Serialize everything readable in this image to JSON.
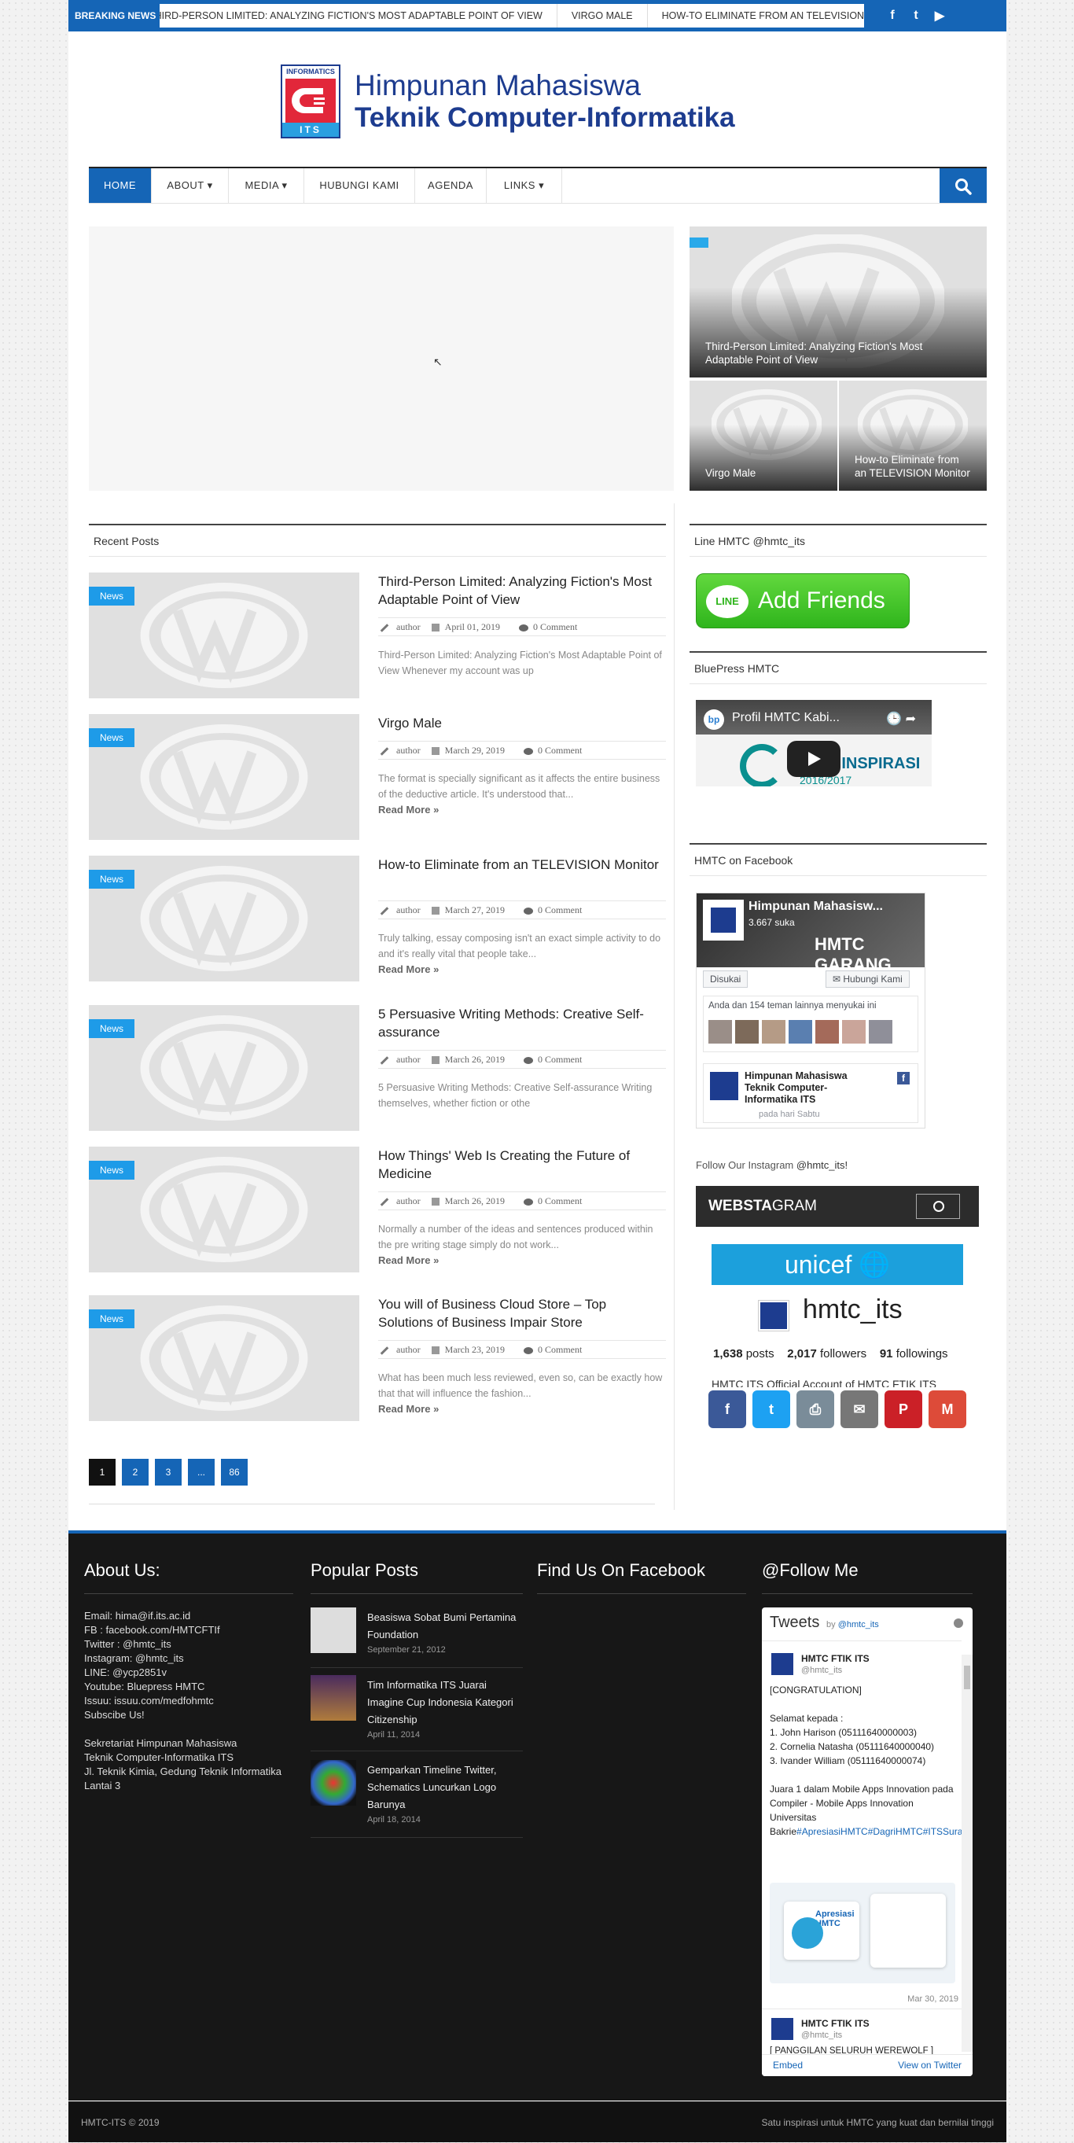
{
  "topbar": {
    "breaking_label": "BREAKING NEWS",
    "ticker": [
      "Third-Person Limited: Analyzing Fiction's Most Adaptable Point of View",
      "Virgo Male",
      "How-to Eliminate from an TELEVISION Monitor"
    ],
    "social": [
      "f",
      "t",
      "▶"
    ]
  },
  "header": {
    "logo_top": "INFORMATICS",
    "logo_bottom": "ITS",
    "title_line1": "Himpunan Mahasiswa",
    "title_line2": "Teknik Computer-Informatika"
  },
  "nav": {
    "items": [
      "HOME",
      "ABOUT ▾",
      "MEDIA ▾",
      "HUBUNGI KAMI",
      "AGENDA",
      "LINKS ▾"
    ]
  },
  "hero": {
    "cursor": "↖",
    "tiles": [
      {
        "caption": "Third-Person Limited: Analyzing Fiction's Most Adaptable Point of View"
      },
      {
        "caption": "Virgo Male"
      },
      {
        "caption": "How-to Eliminate from an TELEVISION Monitor"
      }
    ]
  },
  "recent": {
    "heading": "Recent Posts",
    "posts": [
      {
        "tag": "News",
        "title": "Third-Person Limited: Analyzing Fiction's Most Adaptable Point of View",
        "author": "author",
        "date": "April 01, 2019",
        "comments": "0 Comment",
        "excerpt": "Third-Person Limited: Analyzing Fiction's Most Adaptable Point of View Whenever my account was up",
        "read_more": ""
      },
      {
        "tag": "News",
        "title": "Virgo Male",
        "author": "author",
        "date": "March 29, 2019",
        "comments": "0 Comment",
        "excerpt": "The format is specially significant as it affects the entire business of the deductive article. It's understood that...",
        "read_more": "Read More »"
      },
      {
        "tag": "News",
        "title": "How-to Eliminate from an TELEVISION Monitor",
        "author": "author",
        "date": "March 27, 2019",
        "comments": "0 Comment",
        "excerpt": "Truly talking, essay composing isn't an exact simple activity to do and it's really vital that people take...",
        "read_more": "Read More »"
      },
      {
        "tag": "News",
        "title": "5 Persuasive Writing Methods: Creative Self-assurance",
        "author": "author",
        "date": "March 26, 2019",
        "comments": "0 Comment",
        "excerpt": "5 Persuasive Writing Methods: Creative Self-assurance Writing themselves, whether fiction or othe",
        "read_more": ""
      },
      {
        "tag": "News",
        "title": "How Things' Web Is Creating the Future of Medicine",
        "author": "author",
        "date": "March 26, 2019",
        "comments": "0 Comment",
        "excerpt": "Normally a number of the ideas and sentences produced within the pre writing stage simply do not work...",
        "read_more": "Read More »"
      },
      {
        "tag": "News",
        "title": "You will of Business Cloud Store – Top Solutions of Business Impair Store",
        "author": "author",
        "date": "March 23, 2019",
        "comments": "0 Comment",
        "excerpt": "What has been much less reviewed, even so, can be exactly how that that will influence the fashion...",
        "read_more": "Read More »"
      }
    ],
    "pager": [
      "1",
      "2",
      "3",
      "...",
      "86"
    ]
  },
  "sidebar": {
    "line_heading": "Line HMTC @hmtc_its",
    "line_bubble": "LINE",
    "line_button": "Add Friends",
    "bluepress_heading": "BluePress HMTC",
    "video_logo": "bp",
    "video_title": "Profil HMTC Kabi...",
    "video_icons": "🕒  ➦",
    "video_inspirasi": "HMTC INSPIRASI",
    "video_year": "2016/2017",
    "facebook_heading": "HMTC on Facebook",
    "fb_name": "Himpunan Mahasisw...",
    "fb_likes": "3.667 suka",
    "fb_cover_text": "HMTC GARANG",
    "fb_like_btn": "Disukai",
    "fb_contact_btn": "✉ Hubungi Kami",
    "fb_friends_text": "Anda dan 154 teman lainnya menyukai ini",
    "fb_post_name": "Himpunan Mahasiswa Teknik Computer-Informatika ITS",
    "fb_post_date": "pada hari Sabtu",
    "ig_label": "Follow Our Instagram",
    "ig_label_handle": "@hmtc_its!",
    "websta_a": "WEBSTA",
    "websta_b": "GRAM",
    "unicef": "unicef 🌐",
    "ig_handle": "hmtc_its",
    "ig_posts": "1,638",
    "ig_posts_label": "posts",
    "ig_followers": "2,017",
    "ig_followers_label": "followers",
    "ig_following": "91",
    "ig_following_label": "followings",
    "ig_bio": "HMTC ITS  Official Account of HMTC FTIK ITS",
    "share": [
      {
        "label": "f",
        "color": "#3b5998"
      },
      {
        "label": "t",
        "color": "#1da1f2"
      },
      {
        "label": "⎙",
        "color": "#7a8c99"
      },
      {
        "label": "✉",
        "color": "#777777"
      },
      {
        "label": "P",
        "color": "#cb2027"
      },
      {
        "label": "M",
        "color": "#dd4b39"
      }
    ]
  },
  "footer": {
    "about_heading": "About Us:",
    "about_lines": [
      "Email: hima@if.its.ac.id",
      "FB : facebook.com/HMTCFTIf",
      "Twitter : @hmtc_its",
      "Instagram: @hmtc_its",
      "LINE: @ycp2851v",
      "Youtube: Bluepress HMTC",
      "Issuu: issuu.com/medfohmtc",
      "Subscibe Us!",
      "",
      "Sekretariat Himpunan Mahasiswa",
      "Teknik Computer-Informatika ITS",
      "Jl. Teknik Kimia, Gedung Teknik Informatika",
      "Lantai 3"
    ],
    "popular_heading": "Popular Posts",
    "popular": [
      {
        "title": "Beasiswa Sobat Bumi Pertamina Foundation",
        "date": "September 21, 2012"
      },
      {
        "title": "Tim Informatika ITS Juarai Imagine Cup Indonesia Kategori Citizenship",
        "date": "April 11, 2014"
      },
      {
        "title": "Gemparkan Timeline Twitter, Schematics Luncurkan Logo Barunya",
        "date": "April 18, 2014"
      }
    ],
    "find_heading": "Find Us On Facebook",
    "follow_heading": "@Follow Me",
    "tweets_title": "Tweets",
    "tweets_by": "by",
    "tweets_by_handle": "@hmtc_its",
    "tweet_name": "HMTC FTIK ITS",
    "tweet_handle": "@hmtc_its",
    "tweet_text": "[CONGRATULATION]\n\nSelamat kepada :\n1. John Harison (05111640000003)\n2. Cornelia Natasha (05111640000040)\n3. Ivander William (05111640000074)\n\nJuara 1 dalam Mobile Apps Innovation pada Compiler - Mobile Apps Innovation Universitas Bakrie",
    "tweet_tags": "#ApresiasiHMTC#DagriHMTC#ITSSurabaya",
    "tweet_date": "Mar 30, 2019",
    "tweet_img_text": "Apresiasi HMTC",
    "tweet2_name": "HMTC FTIK ITS",
    "tweet2_handle": "@hmtc_its",
    "tweet2_text": "[ PANGGILAN SELURUH WEREWOLF ]",
    "tw_embed": "Embed",
    "tw_view": "View on Twitter",
    "copyright": "HMTC-ITS  © 2019",
    "tagline": "Satu inspirasi untuk HMTC yang kuat dan bernilai tinggi"
  }
}
